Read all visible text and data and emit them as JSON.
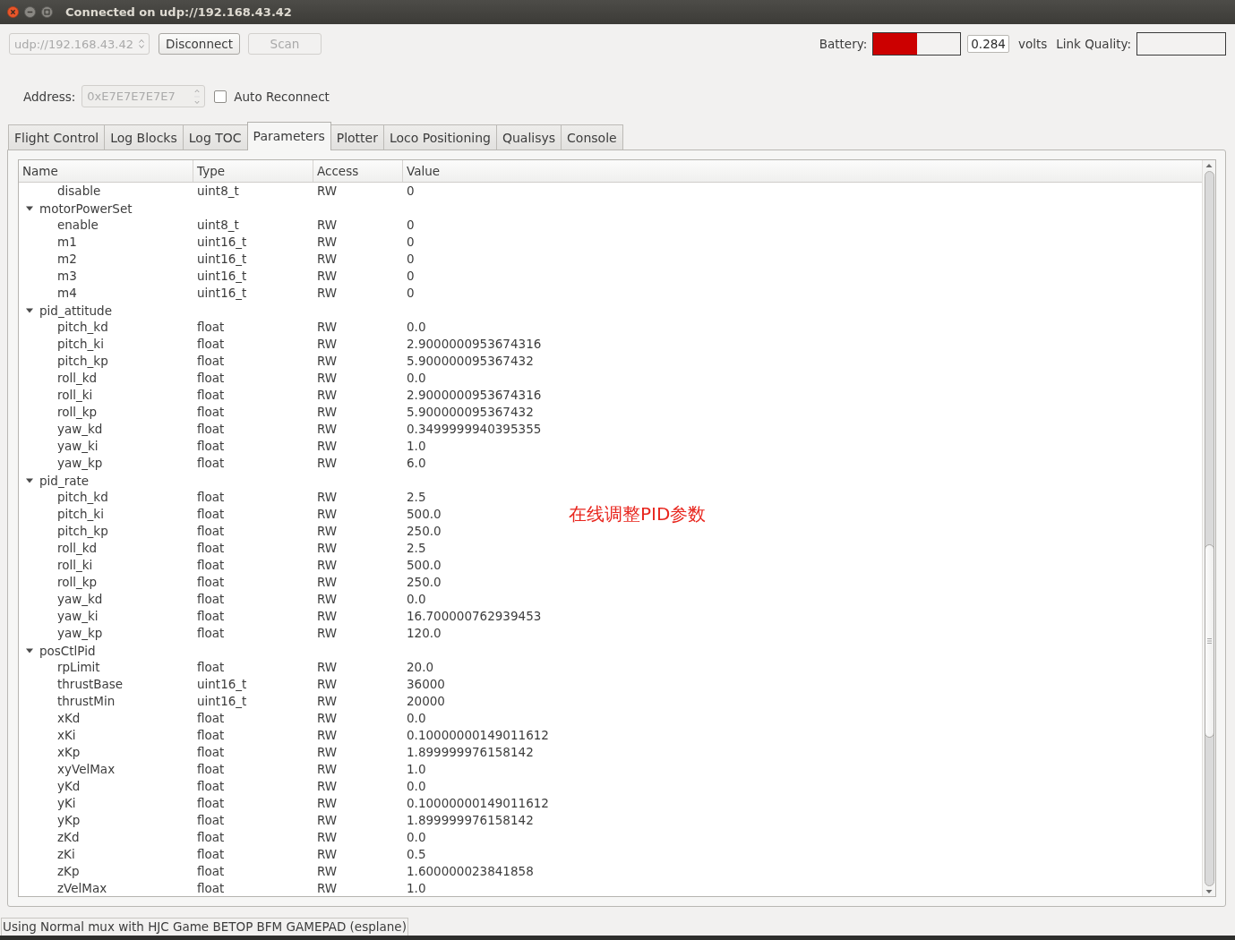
{
  "window": {
    "title": "Connected on udp://192.168.43.42"
  },
  "connection": {
    "uri": "udp://192.168.43.42",
    "disabled": true
  },
  "buttons": [
    {
      "label": "Disconnect",
      "disabled": false
    },
    {
      "label": "Scan",
      "disabled": true
    }
  ],
  "battery": {
    "label": "Battery:",
    "level": 0.5,
    "reading": "0.284",
    "unit": "volts"
  },
  "link_quality": {
    "label": "Link Quality:"
  },
  "address": {
    "label": "Address:",
    "value": "0xE7E7E7E7E7",
    "disabled": true
  },
  "auto_reconnect": {
    "label": "Auto Reconnect",
    "checked": false
  },
  "tabs": [
    {
      "label": "Flight Control",
      "selected": false
    },
    {
      "label": "Log Blocks",
      "selected": false
    },
    {
      "label": "Log TOC",
      "selected": false
    },
    {
      "label": "Parameters",
      "selected": true
    },
    {
      "label": "Plotter",
      "selected": false
    },
    {
      "label": "Loco Positioning",
      "selected": false
    },
    {
      "label": "Qualisys",
      "selected": false
    },
    {
      "label": "Console",
      "selected": false
    }
  ],
  "parameters": {
    "columns": [
      "Name",
      "Type",
      "Access",
      "Value"
    ],
    "groups": [
      {
        "children": [
          {
            "name": "disable",
            "type": "uint8_t",
            "access": "RW",
            "value": "0"
          }
        ]
      },
      {
        "name": "motorPowerSet",
        "expanded": true,
        "children": [
          {
            "name": "enable",
            "type": "uint8_t",
            "access": "RW",
            "value": "0"
          },
          {
            "name": "m1",
            "type": "uint16_t",
            "access": "RW",
            "value": "0"
          },
          {
            "name": "m2",
            "type": "uint16_t",
            "access": "RW",
            "value": "0"
          },
          {
            "name": "m3",
            "type": "uint16_t",
            "access": "RW",
            "value": "0"
          },
          {
            "name": "m4",
            "type": "uint16_t",
            "access": "RW",
            "value": "0"
          }
        ]
      },
      {
        "name": "pid_attitude",
        "expanded": true,
        "children": [
          {
            "name": "pitch_kd",
            "type": "float",
            "access": "RW",
            "value": "0.0"
          },
          {
            "name": "pitch_ki",
            "type": "float",
            "access": "RW",
            "value": "2.9000000953674316"
          },
          {
            "name": "pitch_kp",
            "type": "float",
            "access": "RW",
            "value": "5.900000095367432"
          },
          {
            "name": "roll_kd",
            "type": "float",
            "access": "RW",
            "value": "0.0"
          },
          {
            "name": "roll_ki",
            "type": "float",
            "access": "RW",
            "value": "2.9000000953674316"
          },
          {
            "name": "roll_kp",
            "type": "float",
            "access": "RW",
            "value": "5.900000095367432"
          },
          {
            "name": "yaw_kd",
            "type": "float",
            "access": "RW",
            "value": "0.3499999940395355"
          },
          {
            "name": "yaw_ki",
            "type": "float",
            "access": "RW",
            "value": "1.0"
          },
          {
            "name": "yaw_kp",
            "type": "float",
            "access": "RW",
            "value": "6.0"
          }
        ]
      },
      {
        "name": "pid_rate",
        "expanded": true,
        "children": [
          {
            "name": "pitch_kd",
            "type": "float",
            "access": "RW",
            "value": "2.5"
          },
          {
            "name": "pitch_ki",
            "type": "float",
            "access": "RW",
            "value": "500.0"
          },
          {
            "name": "pitch_kp",
            "type": "float",
            "access": "RW",
            "value": "250.0"
          },
          {
            "name": "roll_kd",
            "type": "float",
            "access": "RW",
            "value": "2.5"
          },
          {
            "name": "roll_ki",
            "type": "float",
            "access": "RW",
            "value": "500.0"
          },
          {
            "name": "roll_kp",
            "type": "float",
            "access": "RW",
            "value": "250.0"
          },
          {
            "name": "yaw_kd",
            "type": "float",
            "access": "RW",
            "value": "0.0"
          },
          {
            "name": "yaw_ki",
            "type": "float",
            "access": "RW",
            "value": "16.700000762939453"
          },
          {
            "name": "yaw_kp",
            "type": "float",
            "access": "RW",
            "value": "120.0"
          }
        ]
      },
      {
        "name": "posCtlPid",
        "expanded": true,
        "children": [
          {
            "name": "rpLimit",
            "type": "float",
            "access": "RW",
            "value": "20.0"
          },
          {
            "name": "thrustBase",
            "type": "uint16_t",
            "access": "RW",
            "value": "36000"
          },
          {
            "name": "thrustMin",
            "type": "uint16_t",
            "access": "RW",
            "value": "20000"
          },
          {
            "name": "xKd",
            "type": "float",
            "access": "RW",
            "value": "0.0"
          },
          {
            "name": "xKi",
            "type": "float",
            "access": "RW",
            "value": "0.10000000149011612"
          },
          {
            "name": "xKp",
            "type": "float",
            "access": "RW",
            "value": "1.899999976158142"
          },
          {
            "name": "xyVelMax",
            "type": "float",
            "access": "RW",
            "value": "1.0"
          },
          {
            "name": "yKd",
            "type": "float",
            "access": "RW",
            "value": "0.0"
          },
          {
            "name": "yKi",
            "type": "float",
            "access": "RW",
            "value": "0.10000000149011612"
          },
          {
            "name": "yKp",
            "type": "float",
            "access": "RW",
            "value": "1.899999976158142"
          },
          {
            "name": "zKd",
            "type": "float",
            "access": "RW",
            "value": "0.0"
          },
          {
            "name": "zKi",
            "type": "float",
            "access": "RW",
            "value": "0.5"
          },
          {
            "name": "zKp",
            "type": "float",
            "access": "RW",
            "value": "1.600000023841858"
          },
          {
            "name": "zVelMax",
            "type": "float",
            "access": "RW",
            "value": "1.0"
          }
        ]
      }
    ]
  },
  "annotation": "在线调整PID参数",
  "status_bar": "Using Normal mux with HJC Game BETOP BFM GAMEPAD (esplane)"
}
